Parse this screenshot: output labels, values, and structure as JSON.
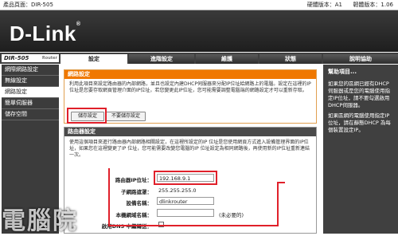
{
  "topbar": {
    "product": "產品頁面：DIR-505",
    "hw": "硬體版本：A1",
    "fw": "韌體版本：1.06"
  },
  "brand": {
    "logo": "D-Link",
    "reg": "®"
  },
  "model": {
    "name": "DIR-505",
    "tag": "Router"
  },
  "tabs": [
    "設定",
    "進階設定",
    "維護",
    "狀態",
    "說明協助"
  ],
  "sidebar": {
    "items": [
      "網際網路設定",
      "無線設定",
      "網路設定",
      "簡單伺服器",
      "儲存空間"
    ]
  },
  "panel1": {
    "title": "網路設定",
    "text": "利用此項目來設定路由器的內部網路，並且也設定內建DHCP伺服器來分配IP位址給網路上的電腦。設定在這裡的IP位址是您要存取網頁管理介面的IP位址，若您變更此IP位址，您可能需要調整電腦端的網路設定才可以重新存取。",
    "save": "儲存設定",
    "nosave": "不要儲存設定"
  },
  "panel2": {
    "title": "路由器設定",
    "text": "使用這個項目來進行路由器內部網路相關設定，在這裡所設定的IP 位址是您使用網頁方式進入設備管理界面的IP位址，如果您在這裡變更了IP 位址，您可能需要改變您電腦的IP 位址設定為相同網路後，再使用新的IP位址重新連結一次。",
    "ip_label": "路由器IP位址：",
    "ip_value": "192.168.9.1",
    "mask_label": "子網路遮罩：",
    "mask_value": "255.255.255.0",
    "devname_label": "設備名稱：",
    "devname_value": "dlinkrouter",
    "domain_label": "本機網域名稱：",
    "domain_note": "(未必要的)",
    "dns_label": "啟用DNS 中繼轉送："
  },
  "help": {
    "title": "幫助項目...",
    "p1": "如果您的區網已經有DHCP伺服器或是您的電腦使用指定IP位址，請不要勾選啟用DHCP伺服器。",
    "p2": "如果區網的電腦使用指定IP位址，請在靜態DHCP 為每個裝置設定IP。"
  },
  "watermark": "電腦院"
}
